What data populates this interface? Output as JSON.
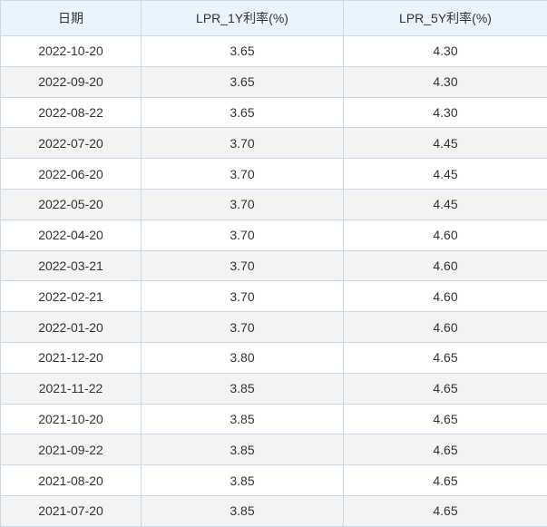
{
  "headers": [
    "日期",
    "LPR_1Y利率(%)",
    "LPR_5Y利率(%)"
  ],
  "rows": [
    [
      "2022-10-20",
      "3.65",
      "4.30"
    ],
    [
      "2022-09-20",
      "3.65",
      "4.30"
    ],
    [
      "2022-08-22",
      "3.65",
      "4.30"
    ],
    [
      "2022-07-20",
      "3.70",
      "4.45"
    ],
    [
      "2022-06-20",
      "3.70",
      "4.45"
    ],
    [
      "2022-05-20",
      "3.70",
      "4.45"
    ],
    [
      "2022-04-20",
      "3.70",
      "4.60"
    ],
    [
      "2022-03-21",
      "3.70",
      "4.60"
    ],
    [
      "2022-02-21",
      "3.70",
      "4.60"
    ],
    [
      "2022-01-20",
      "3.70",
      "4.60"
    ],
    [
      "2021-12-20",
      "3.80",
      "4.65"
    ],
    [
      "2021-11-22",
      "3.85",
      "4.65"
    ],
    [
      "2021-10-20",
      "3.85",
      "4.65"
    ],
    [
      "2021-09-22",
      "3.85",
      "4.65"
    ],
    [
      "2021-08-20",
      "3.85",
      "4.65"
    ],
    [
      "2021-07-20",
      "3.85",
      "4.65"
    ]
  ]
}
